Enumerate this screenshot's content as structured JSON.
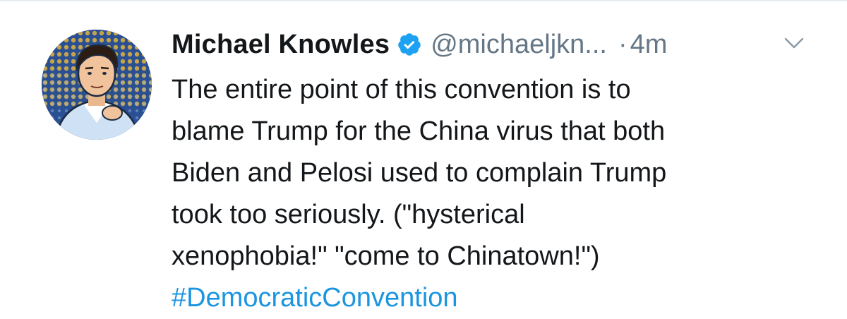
{
  "tweet": {
    "author": {
      "display_name": "Michael Knowles",
      "handle": "@michaeljkn...",
      "verified": true,
      "avatar_icon": "user-avatar-illustration"
    },
    "separator": "·",
    "timestamp": "4m",
    "menu_icon": "chevron-down-icon",
    "body_lines": [
      "The entire point of this convention is to",
      "blame Trump for the China virus that both",
      "Biden and Pelosi used to complain Trump",
      "took too seriously. (\"hysterical",
      "xenophobia!\" \"come to Chinatown!\")"
    ],
    "hashtag": "#DemocraticConvention"
  },
  "colors": {
    "text_primary": "#14171a",
    "text_secondary": "#657786",
    "link": "#1b95e0",
    "verified_badge": "#1da1f2"
  }
}
